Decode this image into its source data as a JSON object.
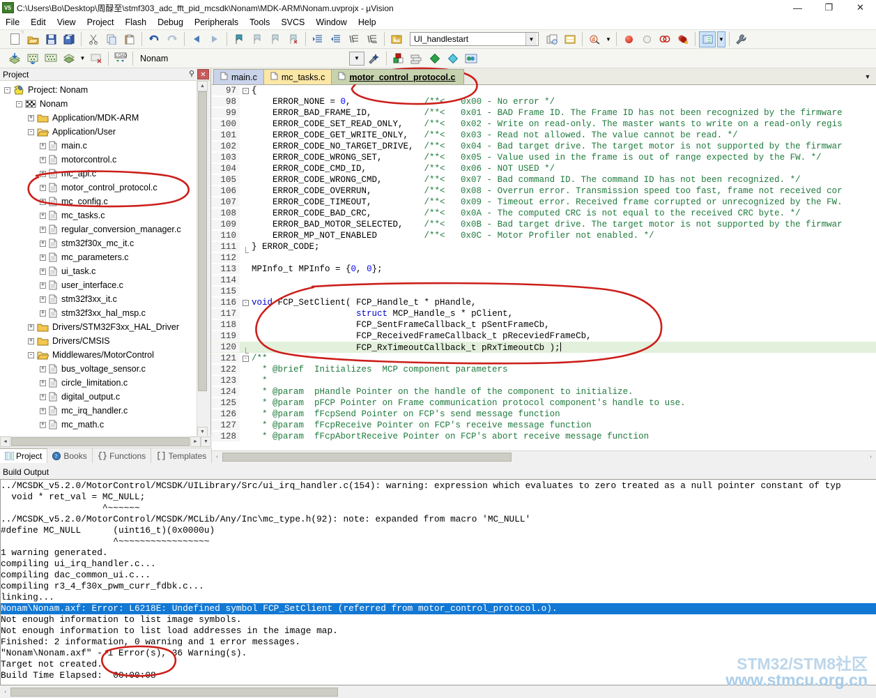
{
  "window": {
    "title": "C:\\Users\\Bo\\Desktop\\周醁至\\stmf303_adc_fft_pid_mcsdk\\Nonam\\MDK-ARM\\Nonam.uvprojx - µVision",
    "app_icon": "uvision-icon",
    "minimize": "—",
    "restore": "❐",
    "close": "✕"
  },
  "menu": {
    "items": [
      "File",
      "Edit",
      "View",
      "Project",
      "Flash",
      "Debug",
      "Peripherals",
      "Tools",
      "SVCS",
      "Window",
      "Help"
    ]
  },
  "toolbar": {
    "target_combo_value": "UI_handlestart",
    "project_combo_value": "Nonam",
    "row1_icons": [
      "new-file-icon",
      "open-file-icon",
      "save-icon",
      "save-all-icon",
      "cut-icon",
      "copy-icon",
      "paste-icon",
      "undo-icon",
      "redo-icon",
      "navigate-back-icon",
      "navigate-forward-icon",
      "bookmark-toggle-icon",
      "bookmark-prev-icon",
      "bookmark-next-icon",
      "bookmark-clear-icon",
      "indent-icon",
      "outdent-icon",
      "comment-icon",
      "uncomment-icon",
      "target-options-icon"
    ],
    "row2_icons": [
      "translate-icon",
      "build-icon",
      "rebuild-icon",
      "batch-build-icon",
      "batch-build-dropdown-icon",
      "stop-build-icon",
      "download-icon"
    ],
    "row2_right_icons": [
      "target-options-icon",
      "configuration-wizard-icon",
      "manage-project-items-icon",
      "manage-multi-project-icon",
      "pack-installer-icon",
      "manage-runtime-icon",
      "select-software-packs-icon"
    ],
    "debug_icons": [
      "start-debug-icon",
      "insert-breakpoint-icon",
      "disable-breakpoint-icon",
      "kill-all-breakpoints-icon"
    ],
    "right_icons": [
      "project-window-icon",
      "project-window-dropdown-icon",
      "utilities-icon"
    ]
  },
  "project_panel": {
    "title": "Project",
    "pin_icon": "pin-icon",
    "close_icon": "close-icon",
    "tabs": [
      {
        "label": "Project",
        "icon": "project-tab-icon",
        "active": true
      },
      {
        "label": "Books",
        "icon": "books-tab-icon",
        "active": false
      },
      {
        "label": "Functions",
        "icon": "functions-tab-icon",
        "active": false
      },
      {
        "label": "Templates",
        "icon": "templates-tab-icon",
        "active": false
      }
    ],
    "tree": [
      {
        "label": "Project: Nonam",
        "indent": 0,
        "expander": "-",
        "icon": "project-icon"
      },
      {
        "label": "Nonam",
        "indent": 1,
        "expander": "-",
        "icon": "target-icon"
      },
      {
        "label": "Application/MDK-ARM",
        "indent": 2,
        "expander": "+",
        "icon": "folder-icon"
      },
      {
        "label": "Application/User",
        "indent": 2,
        "expander": "-",
        "icon": "folder-open-icon"
      },
      {
        "label": "main.c",
        "indent": 3,
        "expander": "+",
        "icon": "file-icon"
      },
      {
        "label": "motorcontrol.c",
        "indent": 3,
        "expander": "+",
        "icon": "file-icon"
      },
      {
        "label": "mc_api.c",
        "indent": 3,
        "expander": "+",
        "icon": "file-icon"
      },
      {
        "label": "motor_control_protocol.c",
        "indent": 3,
        "expander": "+",
        "icon": "file-icon"
      },
      {
        "label": "mc_config.c",
        "indent": 3,
        "expander": "+",
        "icon": "file-icon"
      },
      {
        "label": "mc_tasks.c",
        "indent": 3,
        "expander": "+",
        "icon": "file-icon"
      },
      {
        "label": "regular_conversion_manager.c",
        "indent": 3,
        "expander": "+",
        "icon": "file-icon"
      },
      {
        "label": "stm32f30x_mc_it.c",
        "indent": 3,
        "expander": "+",
        "icon": "file-icon"
      },
      {
        "label": "mc_parameters.c",
        "indent": 3,
        "expander": "+",
        "icon": "file-icon"
      },
      {
        "label": "ui_task.c",
        "indent": 3,
        "expander": "+",
        "icon": "file-icon"
      },
      {
        "label": "user_interface.c",
        "indent": 3,
        "expander": "+",
        "icon": "file-icon"
      },
      {
        "label": "stm32f3xx_it.c",
        "indent": 3,
        "expander": "+",
        "icon": "file-icon"
      },
      {
        "label": "stm32f3xx_hal_msp.c",
        "indent": 3,
        "expander": "+",
        "icon": "file-icon"
      },
      {
        "label": "Drivers/STM32F3xx_HAL_Driver",
        "indent": 2,
        "expander": "+",
        "icon": "folder-icon"
      },
      {
        "label": "Drivers/CMSIS",
        "indent": 2,
        "expander": "+",
        "icon": "folder-icon"
      },
      {
        "label": "Middlewares/MotorControl",
        "indent": 2,
        "expander": "-",
        "icon": "folder-open-icon"
      },
      {
        "label": "bus_voltage_sensor.c",
        "indent": 3,
        "expander": "+",
        "icon": "file-icon"
      },
      {
        "label": "circle_limitation.c",
        "indent": 3,
        "expander": "+",
        "icon": "file-icon"
      },
      {
        "label": "digital_output.c",
        "indent": 3,
        "expander": "+",
        "icon": "file-icon"
      },
      {
        "label": "mc_irq_handler.c",
        "indent": 3,
        "expander": "+",
        "icon": "file-icon"
      },
      {
        "label": "mc_math.c",
        "indent": 3,
        "expander": "+",
        "icon": "file-icon"
      }
    ]
  },
  "editor": {
    "tabs": [
      {
        "label": "main.c",
        "color": "blue",
        "active": false
      },
      {
        "label": "mc_tasks.c",
        "color": "yellow",
        "active": false
      },
      {
        "label": "motor_control_protocol.c",
        "color": "green",
        "active": true
      }
    ],
    "dropdown_icon": "chevron-down-icon",
    "lines": [
      {
        "n": "97",
        "fold": "-",
        "text": "{"
      },
      {
        "n": "98",
        "fold": "|",
        "text": "    ERROR_NONE = 0,              /**<   0x00 - No error */"
      },
      {
        "n": "99",
        "fold": "|",
        "text": "    ERROR_BAD_FRAME_ID,          /**<   0x01 - BAD Frame ID. The Frame ID has not been recognized by the firmware"
      },
      {
        "n": "100",
        "fold": "|",
        "text": "    ERROR_CODE_SET_READ_ONLY,    /**<   0x02 - Write on read-only. The master wants to write on a read-only regis"
      },
      {
        "n": "101",
        "fold": "|",
        "text": "    ERROR_CODE_GET_WRITE_ONLY,   /**<   0x03 - Read not allowed. The value cannot be read. */"
      },
      {
        "n": "102",
        "fold": "|",
        "text": "    ERROR_CODE_NO_TARGET_DRIVE,  /**<   0x04 - Bad target drive. The target motor is not supported by the firmwar"
      },
      {
        "n": "103",
        "fold": "|",
        "text": "    ERROR_CODE_WRONG_SET,        /**<   0x05 - Value used in the frame is out of range expected by the FW. */"
      },
      {
        "n": "104",
        "fold": "|",
        "text": "    ERROR_CODE_CMD_ID,           /**<   0x06 - NOT USED */"
      },
      {
        "n": "105",
        "fold": "|",
        "text": "    ERROR_CODE_WRONG_CMD,        /**<   0x07 - Bad command ID. The command ID has not been recognized. */"
      },
      {
        "n": "106",
        "fold": "|",
        "text": "    ERROR_CODE_OVERRUN,          /**<   0x08 - Overrun error. Transmission speed too fast, frame not received cor"
      },
      {
        "n": "107",
        "fold": "|",
        "text": "    ERROR_CODE_TIMEOUT,          /**<   0x09 - Timeout error. Received frame corrupted or unrecognized by the FW."
      },
      {
        "n": "108",
        "fold": "|",
        "text": "    ERROR_CODE_BAD_CRC,          /**<   0x0A - The computed CRC is not equal to the received CRC byte. */"
      },
      {
        "n": "109",
        "fold": "|",
        "text": "    ERROR_BAD_MOTOR_SELECTED,    /**<   0x0B - Bad target drive. The target motor is not supported by the firmwar"
      },
      {
        "n": "110",
        "fold": "|",
        "text": "    ERROR_MP_NOT_ENABLED         /**<   0x0C - Motor Profiler not enabled. */"
      },
      {
        "n": "111",
        "fold": "L",
        "text": "} ERROR_CODE;"
      },
      {
        "n": "112",
        "fold": "",
        "text": ""
      },
      {
        "n": "113",
        "fold": "",
        "text": "MPInfo_t MPInfo = {0, 0};"
      },
      {
        "n": "114",
        "fold": "",
        "text": ""
      },
      {
        "n": "115",
        "fold": "",
        "text": ""
      },
      {
        "n": "116",
        "fold": "-",
        "text": "void FCP_SetClient( FCP_Handle_t * pHandle,"
      },
      {
        "n": "117",
        "fold": "|",
        "text": "                    struct MCP_Handle_s * pClient,"
      },
      {
        "n": "118",
        "fold": "|",
        "text": "                    FCP_SentFrameCallback_t pSentFrameCb,"
      },
      {
        "n": "119",
        "fold": "|",
        "text": "                    FCP_ReceivedFrameCallback_t pReceviedFrameCb,"
      },
      {
        "n": "120",
        "fold": "L",
        "text": "                    FCP_RxTimeoutCallback_t pRxTimeoutCb );",
        "highlight": true
      },
      {
        "n": "121",
        "fold": "-",
        "text": "/**"
      },
      {
        "n": "122",
        "fold": "|",
        "text": "  * @brief  Initializes  MCP component parameters"
      },
      {
        "n": "123",
        "fold": "|",
        "text": "  *"
      },
      {
        "n": "124",
        "fold": "|",
        "text": "  * @param  pHandle Pointer on the handle of the component to initialize."
      },
      {
        "n": "125",
        "fold": "|",
        "text": "  * @param  pFCP Pointer on Frame communication protocol component's handle to use."
      },
      {
        "n": "126",
        "fold": "|",
        "text": "  * @param  fFcpSend Pointer on FCP's send message function"
      },
      {
        "n": "127",
        "fold": "|",
        "text": "  * @param  fFcpReceive Pointer on FCP's receive message function"
      },
      {
        "n": "128",
        "fold": "|",
        "text": "  * @param  fFcpAbortReceive Pointer on FCP's abort receive message function"
      }
    ]
  },
  "build_output": {
    "title": "Build Output",
    "lines": [
      {
        "text": "../MCSDK_v5.2.0/MotorControl/MCSDK/UILibrary/Src/ui_irq_handler.c(154): warning: expression which evaluates to zero treated as a null pointer constant of typ"
      },
      {
        "text": "  void * ret_val = MC_NULL;"
      },
      {
        "text": "                   ^~~~~~~"
      },
      {
        "text": "../MCSDK_v5.2.0/MotorControl/MCSDK/MCLib/Any/Inc\\mc_type.h(92): note: expanded from macro 'MC_NULL'"
      },
      {
        "text": "#define MC_NULL      (uint16_t)(0x0000u)"
      },
      {
        "text": "                     ^~~~~~~~~~~~~~~~~~"
      },
      {
        "text": "1 warning generated."
      },
      {
        "text": "compiling ui_irq_handler.c..."
      },
      {
        "text": "compiling dac_common_ui.c..."
      },
      {
        "text": "compiling r3_4_f30x_pwm_curr_fdbk.c..."
      },
      {
        "text": "linking..."
      },
      {
        "text": "Nonam\\Nonam.axf: Error: L6218E: Undefined symbol FCP_SetClient (referred from motor_control_protocol.o).",
        "selected": true
      },
      {
        "text": "Not enough information to list image symbols."
      },
      {
        "text": "Not enough information to list load addresses in the image map."
      },
      {
        "text": "Finished: 2 information, 0 warning and 1 error messages."
      },
      {
        "text": "\"Nonam\\Nonam.axf\" - 1 Error(s), 36 Warning(s)."
      },
      {
        "text": "Target not created."
      },
      {
        "text": "Build Time Elapsed:  00:00:08"
      }
    ]
  },
  "watermark": {
    "line1": "STM32/STM8社区",
    "line2": "www.stmcu.org.cn"
  },
  "annotations": {
    "color": "#cc1f1a",
    "marks": [
      "circle-tree-motor-control-protocol",
      "circle-tab-motor-control-protocol",
      "circle-fcp-setclient-declaration",
      "circle-error-count"
    ]
  }
}
